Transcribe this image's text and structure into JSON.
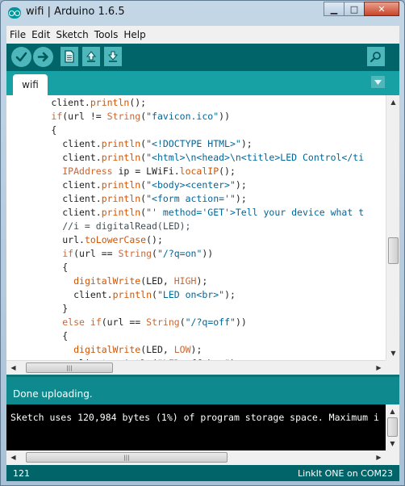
{
  "window": {
    "title": "wifi | Arduino 1.6.5",
    "minimize_glyph": "▁",
    "maximize_glyph": "□",
    "close_glyph": "✕"
  },
  "menu": [
    "File",
    "Edit",
    "Sketch",
    "Tools",
    "Help"
  ],
  "toolbar": {
    "verify_icon": "checkmark-icon",
    "upload_icon": "arrow-right-icon",
    "new_icon": "file-icon",
    "open_icon": "arrow-up-icon",
    "save_icon": "arrow-down-icon",
    "serial_monitor_icon": "magnifier-icon"
  },
  "tabs": [
    {
      "label": "wifi"
    }
  ],
  "editor": {
    "lines": [
      [
        {
          "t": "        client.",
          "c": ""
        },
        {
          "t": "println",
          "c": "fn"
        },
        {
          "t": "();",
          "c": ""
        }
      ],
      [
        {
          "t": "        ",
          "c": ""
        },
        {
          "t": "if",
          "c": "kw"
        },
        {
          "t": "(url != ",
          "c": ""
        },
        {
          "t": "String",
          "c": "typ"
        },
        {
          "t": "(",
          "c": ""
        },
        {
          "t": "\"favicon.ico\"",
          "c": "str"
        },
        {
          "t": "))",
          "c": ""
        }
      ],
      [
        {
          "t": "        {",
          "c": ""
        }
      ],
      [
        {
          "t": "          client.",
          "c": ""
        },
        {
          "t": "println",
          "c": "fn"
        },
        {
          "t": "(",
          "c": ""
        },
        {
          "t": "\"<!DOCTYPE HTML>\"",
          "c": "str"
        },
        {
          "t": ");",
          "c": ""
        }
      ],
      [
        {
          "t": "          client.",
          "c": ""
        },
        {
          "t": "println",
          "c": "fn"
        },
        {
          "t": "(",
          "c": ""
        },
        {
          "t": "\"<html>\\n<head>\\n<title>LED Control</ti",
          "c": "str"
        }
      ],
      [
        {
          "t": "          ",
          "c": ""
        },
        {
          "t": "IPAddress",
          "c": "typ"
        },
        {
          "t": " ip = LWiFi.",
          "c": ""
        },
        {
          "t": "localIP",
          "c": "fn"
        },
        {
          "t": "();",
          "c": ""
        }
      ],
      [
        {
          "t": "          client.",
          "c": ""
        },
        {
          "t": "println",
          "c": "fn"
        },
        {
          "t": "(",
          "c": ""
        },
        {
          "t": "\"<body><center>\"",
          "c": "str"
        },
        {
          "t": ");",
          "c": ""
        }
      ],
      [
        {
          "t": "          client.",
          "c": ""
        },
        {
          "t": "println",
          "c": "fn"
        },
        {
          "t": "(",
          "c": ""
        },
        {
          "t": "\"<form action='\"",
          "c": "str"
        },
        {
          "t": ");",
          "c": ""
        }
      ],
      [
        {
          "t": "          client.",
          "c": ""
        },
        {
          "t": "println",
          "c": "fn"
        },
        {
          "t": "(",
          "c": ""
        },
        {
          "t": "\"' method='GET'>Tell your device what t",
          "c": "str"
        }
      ],
      [
        {
          "t": "          //i = digitalRead(LED);",
          "c": "cmt"
        }
      ],
      [
        {
          "t": "          url.",
          "c": ""
        },
        {
          "t": "toLowerCase",
          "c": "fn"
        },
        {
          "t": "();",
          "c": ""
        }
      ],
      [
        {
          "t": "          ",
          "c": ""
        },
        {
          "t": "if",
          "c": "kw"
        },
        {
          "t": "(url == ",
          "c": ""
        },
        {
          "t": "String",
          "c": "typ"
        },
        {
          "t": "(",
          "c": ""
        },
        {
          "t": "\"/?q=on\"",
          "c": "str"
        },
        {
          "t": "))",
          "c": ""
        }
      ],
      [
        {
          "t": "          {",
          "c": ""
        }
      ],
      [
        {
          "t": "            ",
          "c": ""
        },
        {
          "t": "digitalWrite",
          "c": "fn"
        },
        {
          "t": "(LED, ",
          "c": ""
        },
        {
          "t": "HIGH",
          "c": "kw"
        },
        {
          "t": ");",
          "c": ""
        }
      ],
      [
        {
          "t": "            client.",
          "c": ""
        },
        {
          "t": "println",
          "c": "fn"
        },
        {
          "t": "(",
          "c": ""
        },
        {
          "t": "\"LED on<br>\"",
          "c": "str"
        },
        {
          "t": ");",
          "c": ""
        }
      ],
      [
        {
          "t": "          }",
          "c": ""
        }
      ],
      [
        {
          "t": "          ",
          "c": ""
        },
        {
          "t": "else",
          "c": "kw"
        },
        {
          "t": " ",
          "c": ""
        },
        {
          "t": "if",
          "c": "kw"
        },
        {
          "t": "(url == ",
          "c": ""
        },
        {
          "t": "String",
          "c": "typ"
        },
        {
          "t": "(",
          "c": ""
        },
        {
          "t": "\"/?q=off\"",
          "c": "str"
        },
        {
          "t": "))",
          "c": ""
        }
      ],
      [
        {
          "t": "          {",
          "c": ""
        }
      ],
      [
        {
          "t": "            ",
          "c": ""
        },
        {
          "t": "digitalWrite",
          "c": "fn"
        },
        {
          "t": "(LED, ",
          "c": ""
        },
        {
          "t": "LOW",
          "c": "kw"
        },
        {
          "t": ");",
          "c": ""
        }
      ],
      [
        {
          "t": "            client.",
          "c": ""
        },
        {
          "t": "println",
          "c": "fn"
        },
        {
          "t": "(",
          "c": ""
        },
        {
          "t": "\"LED off<br>\"",
          "c": "str"
        },
        {
          "t": ");",
          "c": ""
        }
      ]
    ]
  },
  "status": {
    "message": "Done uploading."
  },
  "console": {
    "text": "Sketch uses 120,984 bytes (1%) of program storage space. Maximum i"
  },
  "footer": {
    "line_number": "121",
    "board": "LinkIt ONE on COM23"
  },
  "colors": {
    "toolbar": "#006468",
    "tabstrip": "#17a1a5",
    "status": "#0e8a8e",
    "console_bg": "#000000",
    "string": "#006699",
    "keyword": "#cc6633"
  }
}
